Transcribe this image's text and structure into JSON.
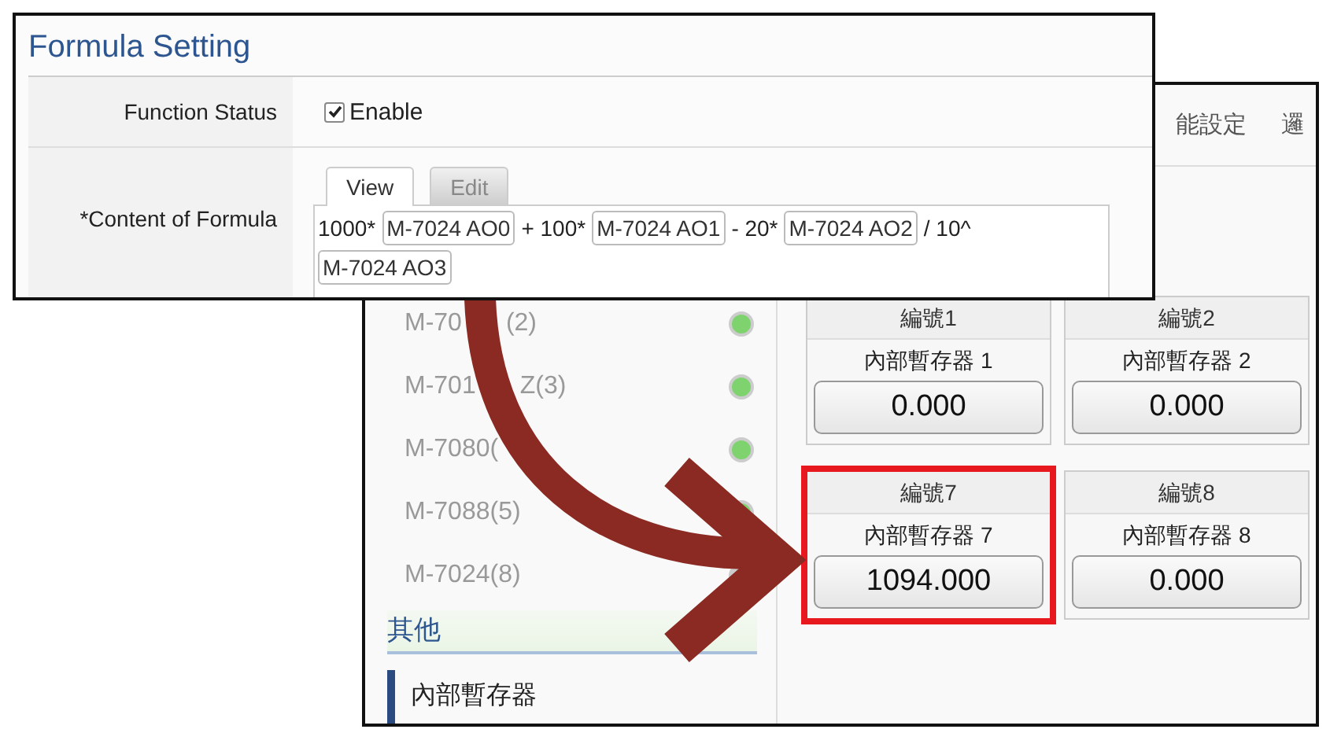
{
  "back_window": {
    "top_tabs": [
      {
        "label": "能設定"
      },
      {
        "label": "邏"
      }
    ],
    "sidebar": {
      "devices": [
        {
          "parts": [
            "M-70",
            "(2)"
          ],
          "online": true
        },
        {
          "parts": [
            "M-701",
            "Z(3)"
          ],
          "online": true
        },
        {
          "parts": [
            "M-7080("
          ],
          "online": true
        },
        {
          "parts": [
            "M-7088(5)"
          ],
          "online": true
        },
        {
          "parts": [
            "M-7024(8)"
          ],
          "online": false
        }
      ],
      "section": "其他",
      "items": [
        {
          "label": "內部暫存器",
          "selected": true
        }
      ]
    },
    "cards": [
      {
        "header": "編號1",
        "name": "內部暫存器 1",
        "value": "0.000",
        "highlighted": false
      },
      {
        "header": "編號2",
        "name": "內部暫存器 2",
        "value": "0.000",
        "highlighted": false
      },
      {
        "header": "編號7",
        "name": "內部暫存器 7",
        "value": "1094.000",
        "highlighted": true
      },
      {
        "header": "編號8",
        "name": "內部暫存器 8",
        "value": "0.000",
        "highlighted": false
      }
    ]
  },
  "front_window": {
    "title": "Formula Setting",
    "function_status": {
      "label": "Function Status",
      "option": "Enable",
      "checked": true
    },
    "content": {
      "label": "*Content of Formula",
      "tabs": [
        {
          "label": "View",
          "selected": true
        },
        {
          "label": "Edit",
          "selected": false
        }
      ],
      "formula": [
        {
          "kind": "text",
          "text": "1000*"
        },
        {
          "kind": "tag",
          "text": "M-7024 AO0"
        },
        {
          "kind": "text",
          "text": "+ 100*"
        },
        {
          "kind": "tag",
          "text": "M-7024 AO1"
        },
        {
          "kind": "text",
          "text": "- 20*"
        },
        {
          "kind": "tag",
          "text": "M-7024 AO2"
        },
        {
          "kind": "text",
          "text": "/ 10^"
        },
        {
          "kind": "tag",
          "text": "M-7024 AO3"
        }
      ]
    }
  }
}
